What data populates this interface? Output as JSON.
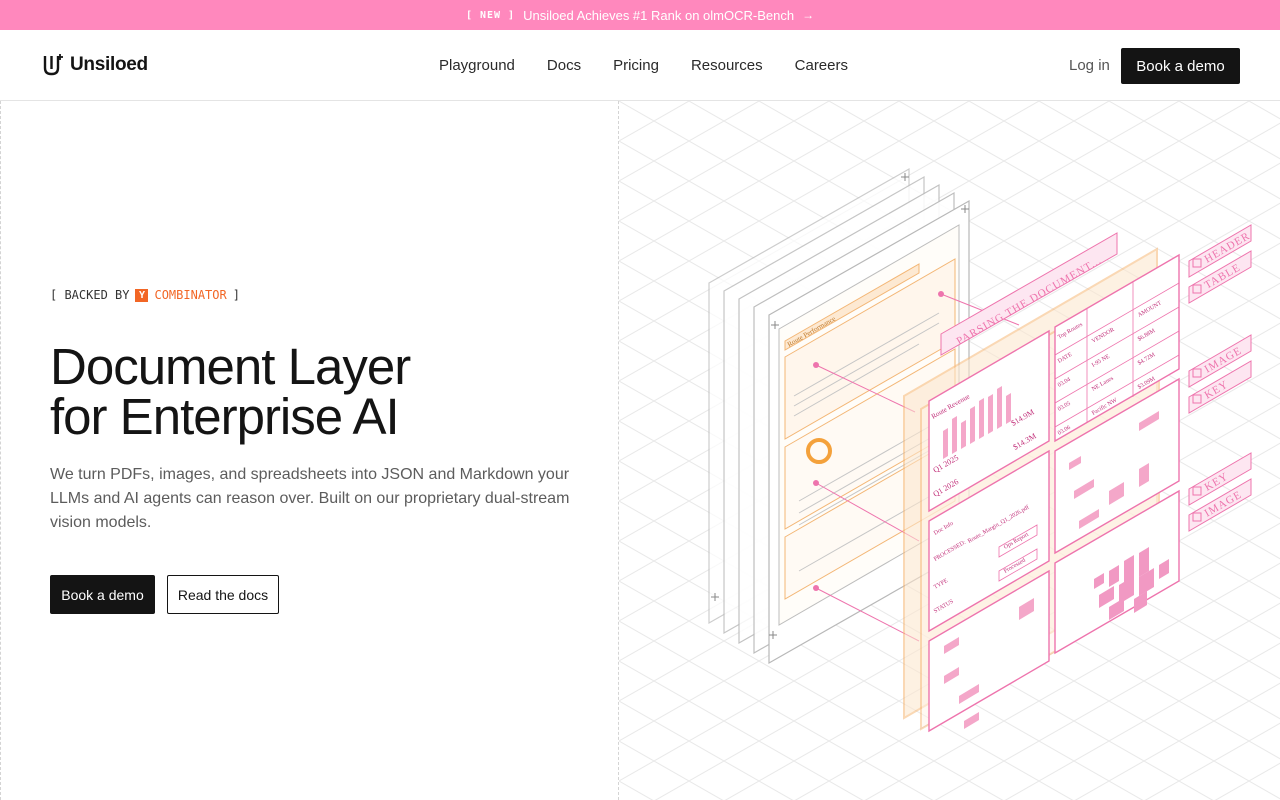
{
  "banner": {
    "badge": "[ NEW ]",
    "text": "Unsiloed Achieves #1 Rank on olmOCR-Bench",
    "arrow": "→"
  },
  "nav": {
    "logo_text": "Unsiloed",
    "links": [
      "Playground",
      "Docs",
      "Pricing",
      "Resources",
      "Careers"
    ],
    "login": "Log in",
    "cta": "Book a demo"
  },
  "hero": {
    "backed_open": "[ BACKED BY",
    "yc_letter": "Y",
    "combinator": "COMBINATOR",
    "backed_close": "]",
    "headline_line1": "Document Layer",
    "headline_line2": "for Enterprise AI",
    "subtext": "We turn PDFs, images, and spreadsheets into JSON and Markdown your LLMs and AI agents can reason over. Built on our proprietary dual-stream vision models.",
    "primary_cta": "Book a demo",
    "secondary_cta": "Read the docs"
  },
  "illustration": {
    "parsing_label": "PARSING THE DOCUMENT...",
    "tags": [
      "HEADER",
      "TABLE",
      "IMAGE",
      "KEY",
      "KEY",
      "IMAGE"
    ],
    "doc_title": "Route Performance",
    "revenue_title": "Route Revenue",
    "routes_title": "Top Routes",
    "doc_info_title": "Doc Info",
    "doc_file": "Route_Margin_Q1_2026.pdf",
    "processed_label": "PROCESSED:",
    "type_label": "TYPE",
    "status_label": "STATUS",
    "doc_type_value": "Ops Report",
    "status_value": "Processed",
    "q1_2025": "Q1 2025",
    "q1_2026": "Q1 2026",
    "rev_2025": "$14.9M",
    "rev_2026": "$14.3M",
    "table_headers": [
      "DATE",
      "VENDOR",
      "AMOUNT"
    ],
    "table_rows": [
      [
        "03.04",
        "I-95 NE",
        "$6.88M"
      ],
      [
        "03.05",
        "NE Lanes",
        "$4.72M"
      ],
      [
        "03.06",
        "Pacific NW",
        "$3.09M"
      ]
    ],
    "colors": {
      "pink": "#ee74ad",
      "orange": "#f7b978",
      "grid": "#e6e6e6"
    }
  }
}
